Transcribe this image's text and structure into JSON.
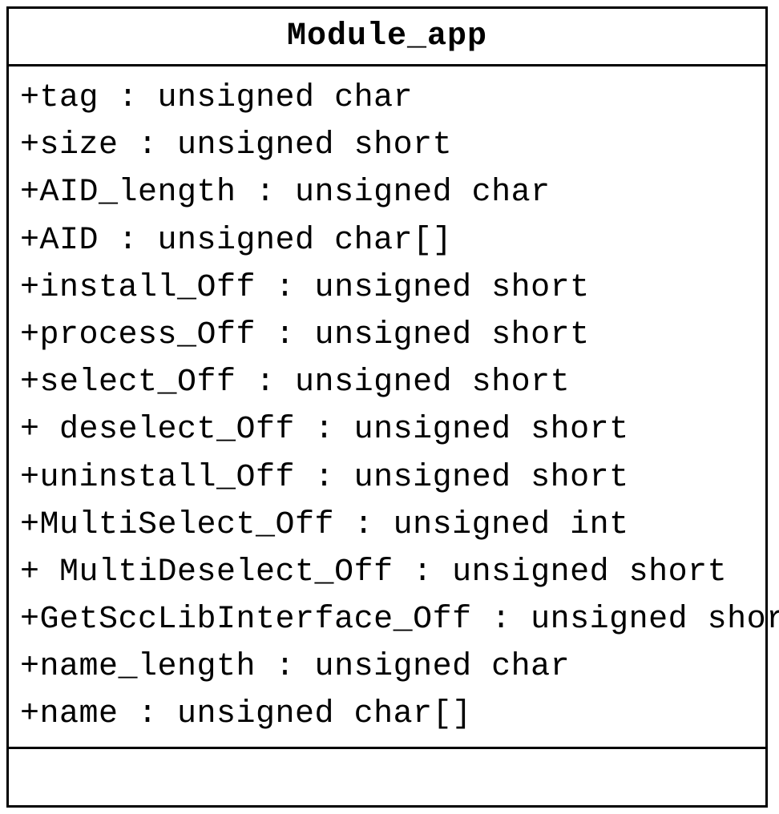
{
  "uml": {
    "class_name": "Module_app",
    "attributes": [
      "+tag : unsigned char",
      "+size : unsigned short",
      "+AID_length : unsigned char",
      "+AID : unsigned char[]",
      "+install_Off : unsigned short",
      "+process_Off : unsigned short",
      "+select_Off : unsigned short",
      "+ deselect_Off : unsigned short",
      "+uninstall_Off : unsigned short",
      "+MultiSelect_Off : unsigned int",
      "+ MultiDeselect_Off : unsigned short",
      "+GetSccLibInterface_Off : unsigned short",
      "+name_length : unsigned char",
      "+name : unsigned char[]"
    ]
  }
}
